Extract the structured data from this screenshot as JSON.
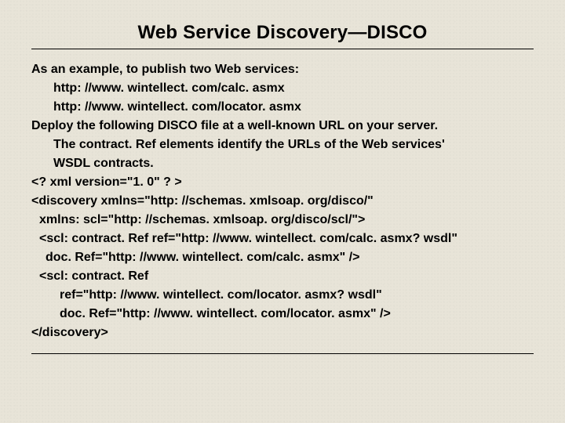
{
  "title": "Web Service Discovery—DISCO",
  "lines": {
    "l1": "As an example, to publish two Web services:",
    "l2": "http: //www. wintellect. com/calc. asmx",
    "l3": "http: //www. wintellect. com/locator. asmx",
    "l4": "Deploy the following DISCO file at a well-known URL on your server.",
    "l5": "The contract. Ref elements identify the URLs of the Web services'",
    "l6": "WSDL contracts.",
    "l7": "<? xml version=\"1. 0\" ? >",
    "l8": "<discovery xmlns=\"http: //schemas. xmlsoap. org/disco/\"",
    "l9": "xmlns: scl=\"http: //schemas. xmlsoap. org/disco/scl/\">",
    "l10": "<scl: contract. Ref ref=\"http: //www. wintellect. com/calc. asmx? wsdl\"",
    "l11": "doc. Ref=\"http: //www. wintellect. com/calc. asmx\" />",
    "l12": "<scl: contract. Ref",
    "l13": "ref=\"http: //www. wintellect. com/locator. asmx? wsdl\"",
    "l14": "doc. Ref=\"http: //www. wintellect. com/locator. asmx\" />",
    "l15": "</discovery>"
  }
}
